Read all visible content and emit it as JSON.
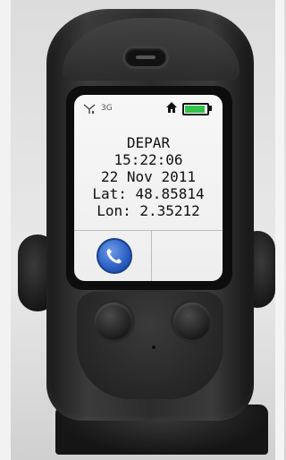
{
  "screen": {
    "network": "3G",
    "battery_level": 1.0,
    "status": "DEPAR",
    "time": "15:22:06",
    "date": "22 Nov 2011",
    "latitude": "Lat: 48.85814",
    "longitude": "Lon: 2.35212"
  },
  "softkeys": {
    "left_icon": "phone-icon",
    "right_label": ""
  },
  "colors": {
    "call_button": "#2a5ec2",
    "battery": "#33c24a",
    "screen_bg": "#f2f2f2",
    "device_body": "#2c2c2c"
  }
}
